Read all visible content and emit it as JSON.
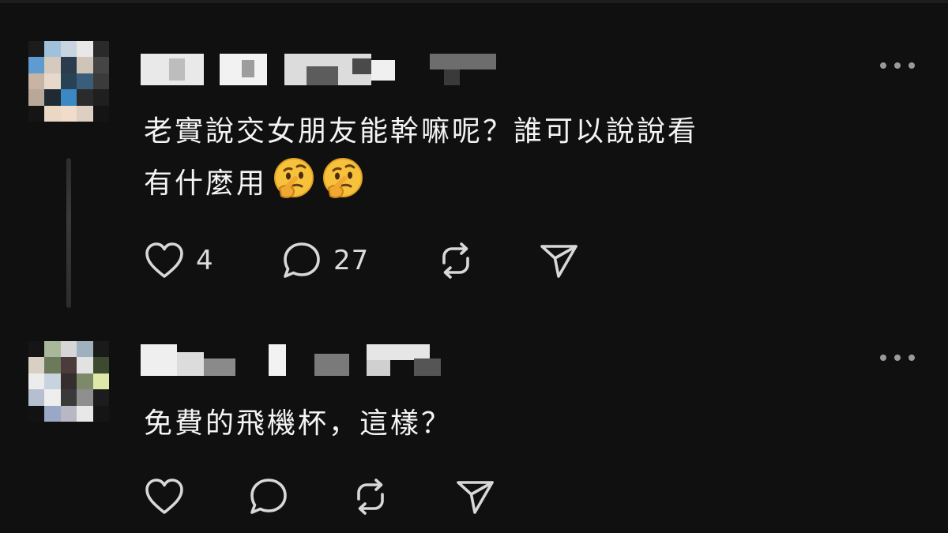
{
  "posts": [
    {
      "text_lines": [
        "老實說交女朋友能幹嘛呢？誰可以說說看",
        "有什麼用"
      ],
      "emojis": [
        "thinking-face",
        "thinking-face"
      ],
      "likes": "4",
      "replies": "27",
      "avatar_colors": [
        "#1c1c1c",
        "#9fc1dc",
        "#c8d4e0",
        "#e8e8e8",
        "#2a2a2a",
        "#5d9bd0",
        "#d5cabd",
        "#2a3c4e",
        "#cfc4b8",
        "#454545",
        "#c9b3a3",
        "#e6d9cc",
        "#284255",
        "#3a5d7a",
        "#3b3b3b",
        "#b8a89a",
        "#202a33",
        "#3b89c4",
        "#2b2b2b",
        "#1f1f1f",
        "#151515",
        "#ead8c5",
        "#f0dcc8",
        "#ddd0c2",
        "#141414"
      ]
    },
    {
      "text_lines": [
        "免費的飛機杯，這樣？"
      ],
      "emojis": [],
      "likes": "",
      "replies": "",
      "avatar_colors": [
        "#151515",
        "#a9b79a",
        "#d6d6d6",
        "#9fb0bf",
        "#1a1a1a",
        "#d8d0c2",
        "#6c7a5c",
        "#4b3b3b",
        "#e2e2e2",
        "#3d4a30",
        "#ececec",
        "#c9d3e0",
        "#342e2e",
        "#7d8a6a",
        "#e0e8a8",
        "#b5bfcf",
        "#eeeeee",
        "#3a3a3a",
        "#8f8f8f",
        "#1c1c1c",
        "#121212",
        "#9aa8c8",
        "#b8b8c4",
        "#e8e8e8",
        "#151515"
      ]
    }
  ],
  "colors": {
    "background": "#101010",
    "text": "#f4f4f4",
    "icon": "#d8d8d8",
    "muted": "#9a9a9a"
  },
  "icons": {
    "like": "heart-icon",
    "reply": "comment-icon",
    "repost": "repost-icon",
    "share": "share-icon",
    "more": "more-icon"
  }
}
